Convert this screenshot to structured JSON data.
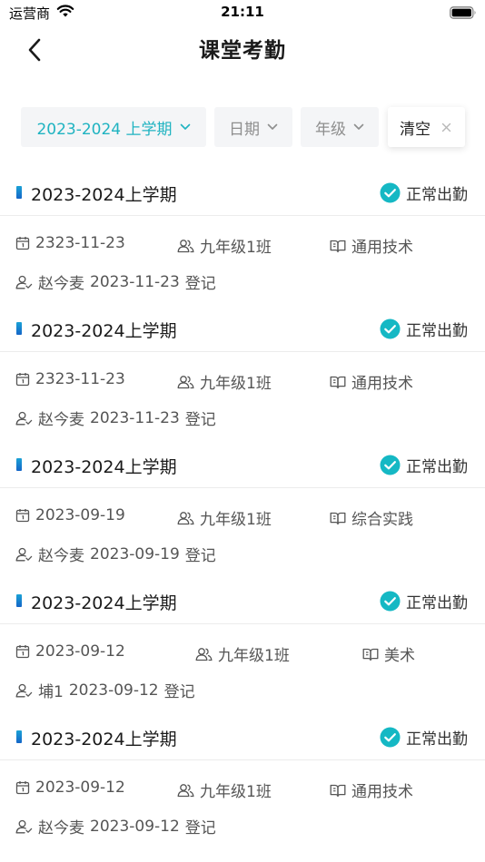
{
  "status_bar": {
    "carrier": "运营商",
    "time": "21:11"
  },
  "nav": {
    "title": "课堂考勤"
  },
  "filters": {
    "semester": "2023-2024 上学期",
    "date": "日期",
    "grade": "年级",
    "clear": "清空"
  },
  "colors": {
    "accent": "#1fb3c1",
    "status_check": "#15b8c4",
    "term_bar": "#1565c8"
  },
  "icons": [
    "back-arrow-icon",
    "chevron-down-icon",
    "close-icon",
    "check-circle-icon",
    "calendar-icon",
    "group-icon",
    "book-icon",
    "person-icon",
    "wifi-icon",
    "battery-icon"
  ],
  "records": [
    {
      "term": "2023-2024上学期",
      "status": "正常出勤",
      "date": "2323-11-23",
      "class": "九年级1班",
      "subject": "通用技术",
      "registrar": "赵今麦",
      "reg_date": "2023-11-23",
      "reg_suffix": "登记"
    },
    {
      "term": "2023-2024上学期",
      "status": "正常出勤",
      "date": "2323-11-23",
      "class": "九年级1班",
      "subject": "通用技术",
      "registrar": "赵今麦",
      "reg_date": "2023-11-23",
      "reg_suffix": "登记"
    },
    {
      "term": "2023-2024上学期",
      "status": "正常出勤",
      "date": "2023-09-19",
      "class": "九年级1班",
      "subject": "综合实践",
      "registrar": "赵今麦",
      "reg_date": "2023-09-19",
      "reg_suffix": "登记"
    },
    {
      "term": "2023-2024上学期",
      "status": "正常出勤",
      "date": "2023-09-12",
      "class": "九年级1班",
      "subject": "美术",
      "registrar": "埔1",
      "reg_date": "2023-09-12",
      "reg_suffix": "登记"
    },
    {
      "term": "2023-2024上学期",
      "status": "正常出勤",
      "date": "2023-09-12",
      "class": "九年级1班",
      "subject": "通用技术",
      "registrar": "赵今麦",
      "reg_date": "2023-09-12",
      "reg_suffix": "登记"
    }
  ]
}
